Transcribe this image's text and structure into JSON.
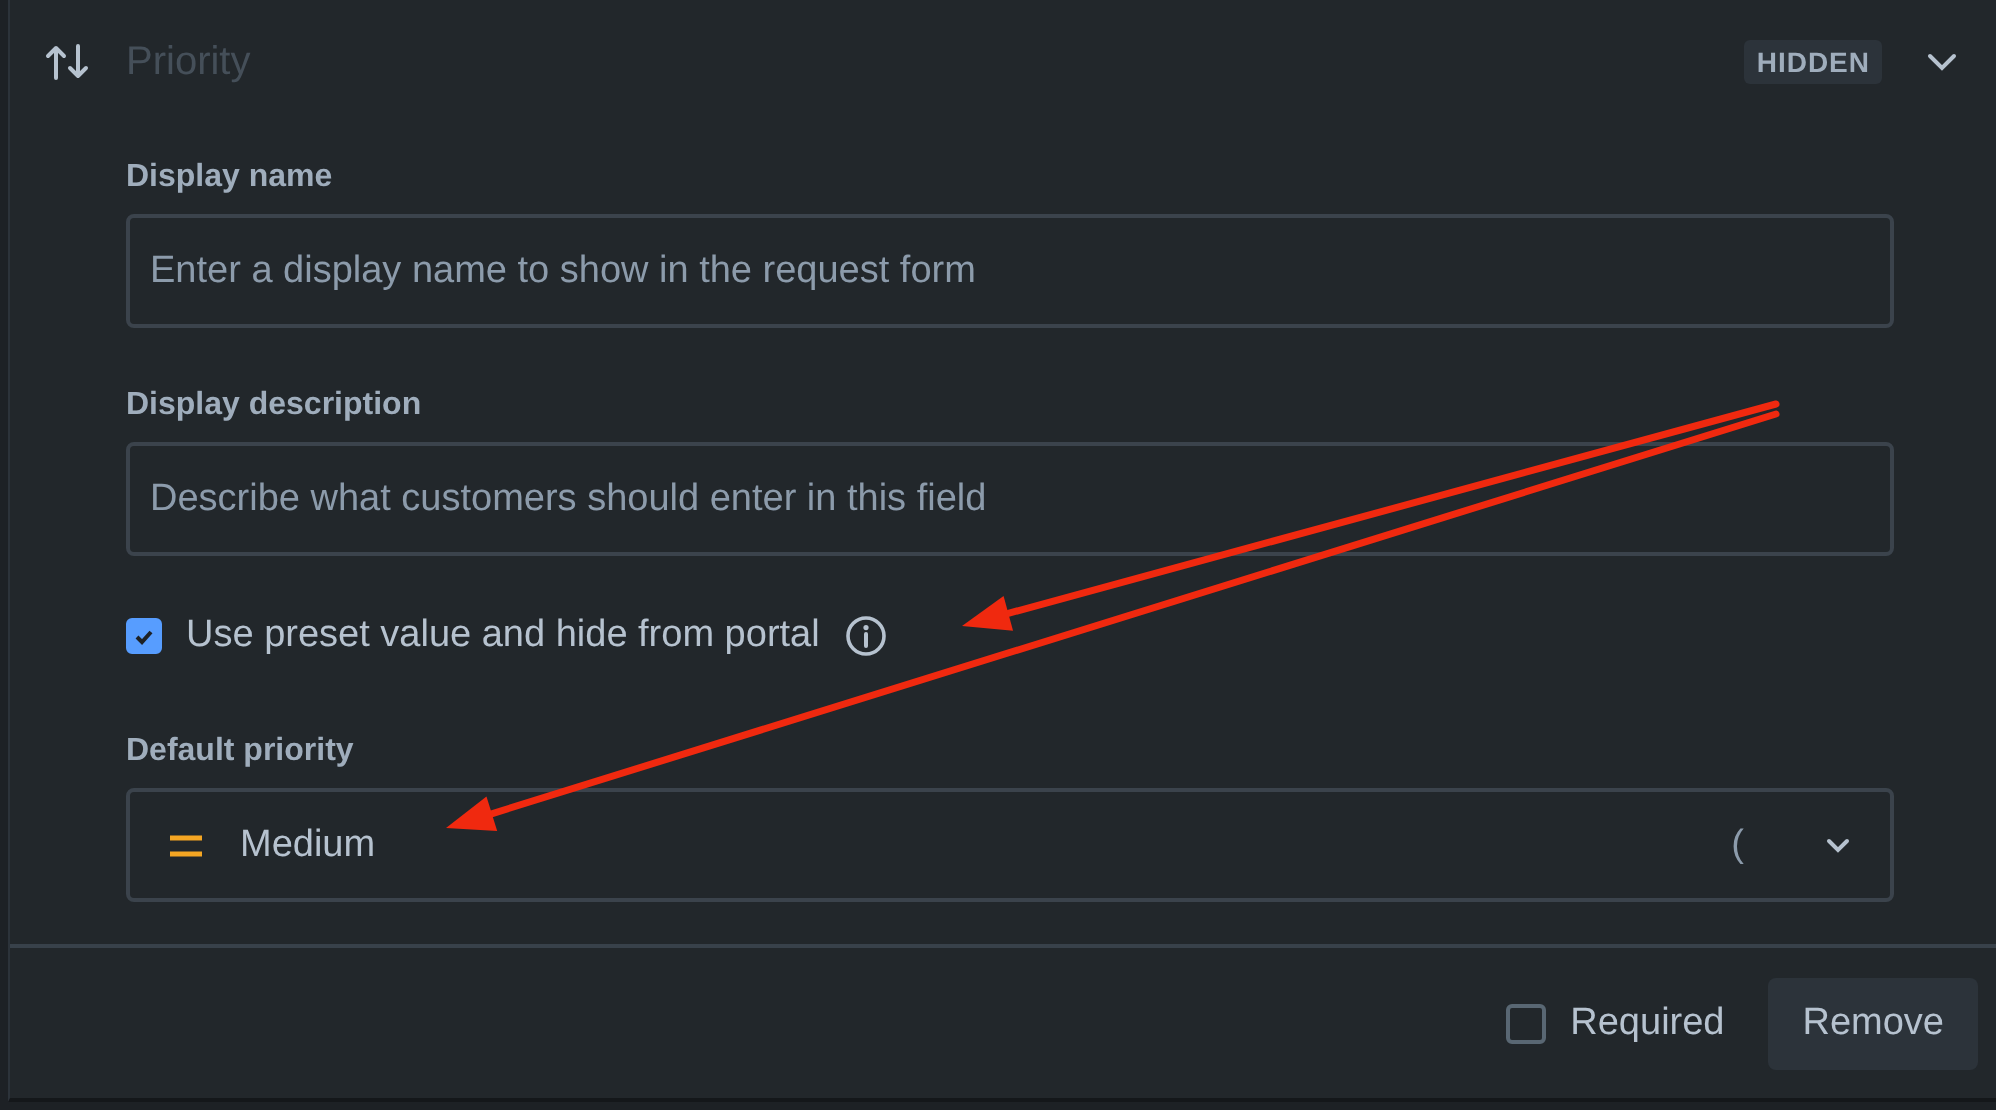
{
  "header": {
    "title": "Priority",
    "badge": "HIDDEN",
    "expanded": true
  },
  "fields": [
    {
      "label": "Display name",
      "placeholder": "Enter a display name to show in the request form"
    },
    {
      "label": "Display description",
      "placeholder": "Describe what customers should enter in this field"
    }
  ],
  "preset": {
    "label": "Use preset value and hide from portal",
    "checked": true
  },
  "default_priority": {
    "label": "Default priority",
    "value": "Medium",
    "loading_glyph": "("
  },
  "footer": {
    "required": {
      "label": "Required",
      "checked": false
    },
    "button": "Remove"
  },
  "annotations": [
    {
      "kind": "arrow"
    },
    {
      "kind": "arrow"
    }
  ]
}
